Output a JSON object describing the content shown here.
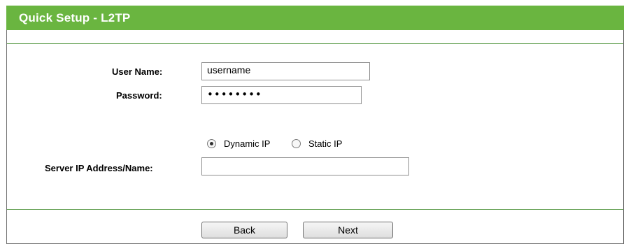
{
  "header": {
    "title": "Quick Setup - L2TP"
  },
  "form": {
    "username_label": "User Name:",
    "username_value": "username",
    "password_label": "Password:",
    "password_value": "••••••••",
    "ip_mode": {
      "dynamic_label": "Dynamic IP",
      "static_label": "Static IP",
      "selected": "Dynamic IP"
    },
    "server_label": "Server IP Address/Name:",
    "server_value": ""
  },
  "buttons": {
    "back_label": "Back",
    "next_label": "Next"
  },
  "colors": {
    "header_green": "#6ab540",
    "divider_green": "#5c9c4a"
  }
}
